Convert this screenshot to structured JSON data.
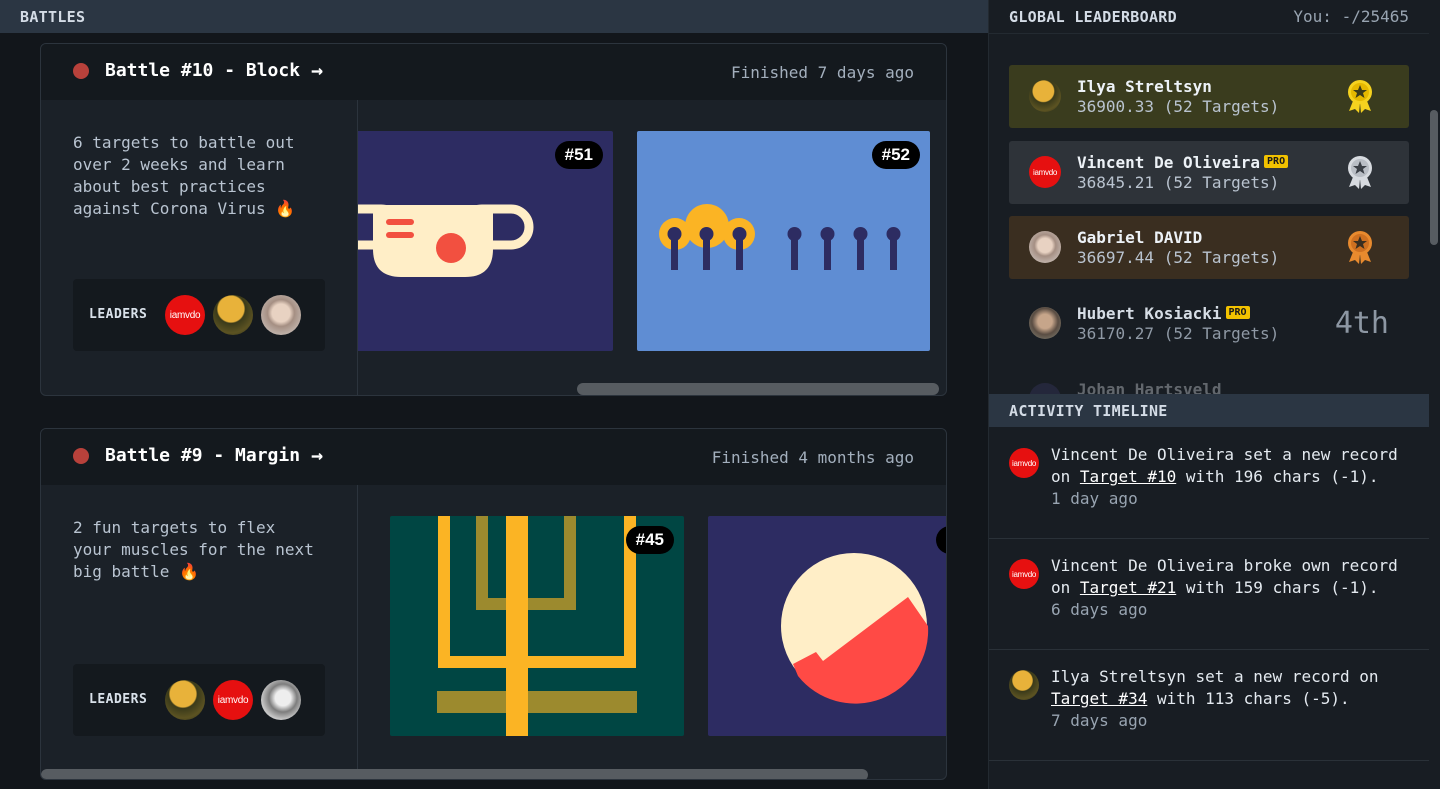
{
  "battles_panel": {
    "title": "BATTLES"
  },
  "battles": [
    {
      "title": "Battle #10 - Block",
      "arrow": "→",
      "status": "Finished 7 days ago",
      "description": "6 targets to battle out over 2 weeks and learn about best practices against Corona Virus 🔥",
      "leaders_label": "LEADERS",
      "leaders": [
        "iamvdo",
        "",
        ""
      ],
      "targets": [
        {
          "tag": "#51",
          "bg": "#2d2c62"
        },
        {
          "tag": "#52",
          "bg": "#5f8dd3"
        }
      ]
    },
    {
      "title": "Battle #9 - Margin",
      "arrow": "→",
      "status": "Finished 4 months ago",
      "description": "2 fun targets to flex your muscles for the next big battle 🔥",
      "leaders_label": "LEADERS",
      "leaders": [
        "",
        "iamvdo",
        ""
      ],
      "targets": [
        {
          "tag": "#45",
          "bg": "#004643"
        },
        {
          "tag": "",
          "bg": "#2d2c62"
        }
      ]
    }
  ],
  "leaderboard": {
    "title": "GLOBAL LEADERBOARD",
    "you": "You: -/25465",
    "rows": [
      {
        "name": "Ilya Streltsyn",
        "pro": "",
        "score": "36900.33 (52 Targets)",
        "rank": "gold",
        "bg": "#3a3c1e"
      },
      {
        "name": "Vincent De Oliveira",
        "pro": "PRO",
        "score": "36845.21 (52 Targets)",
        "rank": "silver",
        "bg": "#2e3339",
        "avatar_text": "iamvdo"
      },
      {
        "name": "Gabriel DAVID",
        "pro": "",
        "score": "36697.44 (52 Targets)",
        "rank": "bronze",
        "bg": "#3a2e20"
      },
      {
        "name": "Hubert Kosiacki",
        "pro": "PRO",
        "score": "36170.27 (52 Targets)",
        "rank": "4th",
        "bg": "#181d23"
      },
      {
        "name": "Johan Hartsveld",
        "pro": "",
        "score": "",
        "rank": "",
        "bg": "#181d23"
      }
    ]
  },
  "activity": {
    "title": "ACTIVITY TIMELINE",
    "items": [
      {
        "avatar_text": "iamvdo",
        "pre": "Vincent De Oliveira set a new record on ",
        "link": "Target #10",
        "post": " with 196 chars (-1).",
        "time": "1 day ago"
      },
      {
        "avatar_text": "iamvdo",
        "pre": "Vincent De Oliveira broke own record on ",
        "link": "Target #21",
        "post": " with 159 chars (-1).",
        "time": "6 days ago"
      },
      {
        "avatar_text": "",
        "pre": "Ilya Streltsyn set a new record on ",
        "link": "Target #34",
        "post": " with 113 chars (-5).",
        "time": "7 days ago"
      }
    ]
  }
}
